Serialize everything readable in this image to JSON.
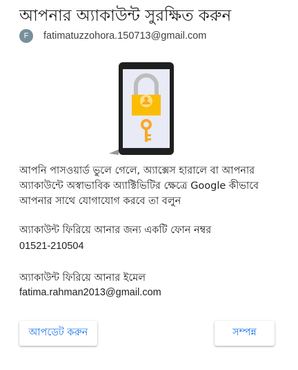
{
  "header": {
    "title": "আপনার অ্যাকাউন্ট সুরক্ষিত করুন",
    "avatar_letter": "F",
    "account_email": "fatimatuzzohora.150713@gmail.com"
  },
  "illustration": {
    "icons": [
      "phone-icon",
      "padlock-icon",
      "key-icon"
    ],
    "colors": {
      "phone_body": "#1f1f1f",
      "screen": "#e8eaf6",
      "lock": "#fbbc04",
      "shackle": "#bdbdbd",
      "key": "#f9a825"
    }
  },
  "main": {
    "description": "আপনি পাসওয়ার্ড ভুলে গেলে, অ্যাক্সেস হারালে বা আপনার অ্যাকাউন্টে অস্বাভাবিক অ্যাক্টিভিটির ক্ষেত্রে Google কীভাবে আপনার সাথে যোগাযোগ করবে তা বলুন",
    "phone_label": "অ্যাকাউন্ট ফিরিয়ে আনার জন্য একটি ফোন নম্বর",
    "phone_value": "01521-210504",
    "email_label": "অ্যাকাউন্ট ফিরিয়ে আনার ইমেল",
    "email_value": "fatima.rahman2013@gmail.com"
  },
  "actions": {
    "update_label": "আপডেট করুন",
    "done_label": "সম্পন্ন"
  },
  "theme": {
    "accent": "#1a73e8"
  }
}
